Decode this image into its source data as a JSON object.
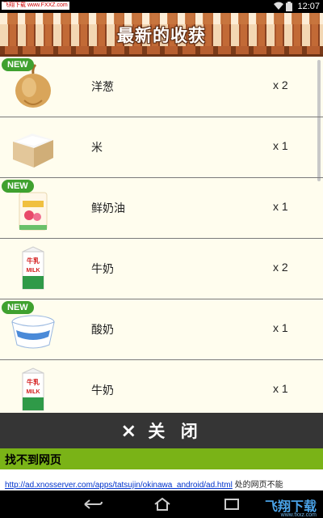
{
  "status_bar": {
    "watermark": "飞翔下载 www.FXXZ.com",
    "time": "12:07",
    "icons": [
      "wifi-icon",
      "battery-icon"
    ]
  },
  "header": {
    "title": "最新的收获"
  },
  "items": [
    {
      "name": "洋葱",
      "qty": "x 2",
      "is_new": true,
      "badge": "NEW",
      "icon": "onion-icon"
    },
    {
      "name": "米",
      "qty": "x 1",
      "is_new": false,
      "badge": "",
      "icon": "rice-box-icon"
    },
    {
      "name": "鲜奶油",
      "qty": "x 1",
      "is_new": true,
      "badge": "NEW",
      "icon": "cream-pack-icon"
    },
    {
      "name": "牛奶",
      "qty": "x 2",
      "is_new": false,
      "badge": "",
      "icon": "milk-carton-icon"
    },
    {
      "name": "酸奶",
      "qty": "x 1",
      "is_new": true,
      "badge": "NEW",
      "icon": "yogurt-cup-icon"
    },
    {
      "name": "牛奶",
      "qty": "x 1",
      "is_new": false,
      "badge": "",
      "icon": "milk-carton-icon"
    }
  ],
  "close_bar": {
    "x": "×",
    "label": "关 闭"
  },
  "ad": {
    "title": "找不到网页",
    "url": "http://ad.xnosserver.com/apps/tatsujin/okinawa_android/ad.html",
    "suffix": " 处的网页不能"
  },
  "milk_label": {
    "top": "牛乳",
    "brand": "MILK"
  },
  "watermark_logo": {
    "main": "飞翔下载",
    "sub": "www.fxxz.com"
  },
  "colors": {
    "badge": "#3fa12f",
    "list_bg": "#fffdee",
    "close_bar": "#353535",
    "ad_header": "#7ab317"
  }
}
